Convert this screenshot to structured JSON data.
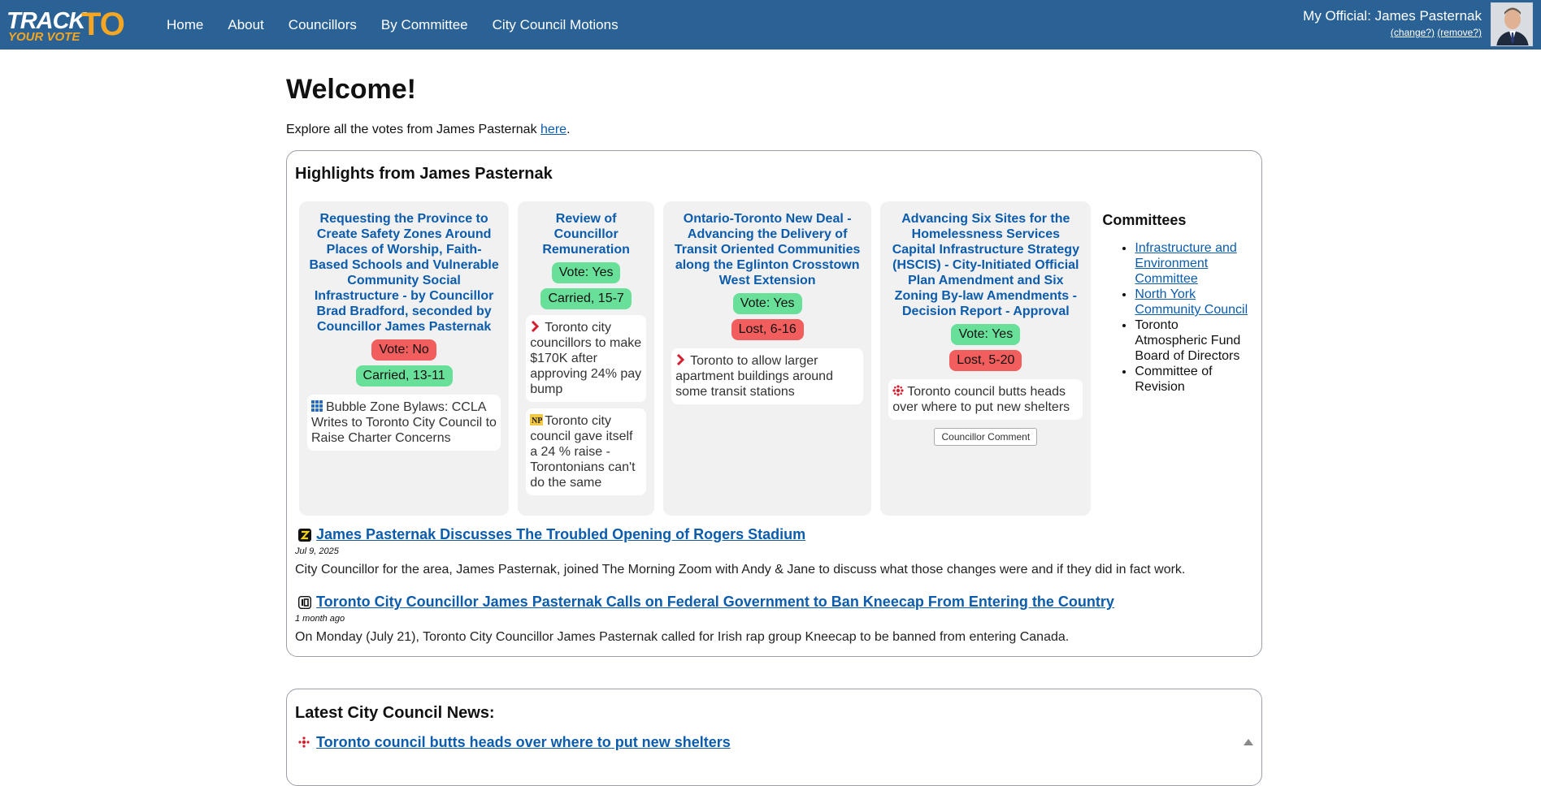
{
  "logo": {
    "line1": "TRACK",
    "line2": "YOUR VOTE",
    "line3": "TO"
  },
  "nav": {
    "items": [
      {
        "label": "Home"
      },
      {
        "label": "About"
      },
      {
        "label": "Councillors"
      },
      {
        "label": "By Committee"
      },
      {
        "label": "City Council Motions"
      }
    ]
  },
  "official": {
    "label": "My Official: James Pasternak",
    "change_link": "(change?)",
    "remove_link": "(remove?)"
  },
  "welcome": {
    "title": "Welcome!",
    "explore_prefix": "Explore all the votes from James Pasternak ",
    "explore_link": "here",
    "explore_suffix": "."
  },
  "highlights": {
    "title": "Highlights from James Pasternak",
    "cards": [
      {
        "title": "Requesting the Province to Create Safety Zones Around Places of Worship, Faith-Based Schools and Vulnerable Community Social Infrastructure - by Councillor Brad Bradford, seconded by Councillor James Pasternak",
        "vote": "Vote: No",
        "result": "Carried, 13-11",
        "news": [
          {
            "icon": "grid-icon",
            "text": "Bubble Zone Bylaws: CCLA Writes to Toronto City Council to Raise Charter Concerns"
          }
        ]
      },
      {
        "title": "Review of Councillor Remuneration",
        "vote": "Vote: Yes",
        "result": "Carried, 15-7",
        "news": [
          {
            "icon": "chevron-icon",
            "text": "Toronto city councillors to make $170K after approving 24% pay bump"
          },
          {
            "icon": "np-icon",
            "text": "Toronto city council gave itself a 24 % raise - Torontonians can't do the same"
          }
        ]
      },
      {
        "title": "Ontario-Toronto New Deal - Advancing the Delivery of Transit Oriented Communities along the Eglinton Crosstown West Extension",
        "vote": "Vote: Yes",
        "result": "Lost, 6-16",
        "news": [
          {
            "icon": "chevron-icon",
            "text": "Toronto to allow larger apartment buildings around some transit stations"
          }
        ]
      },
      {
        "title": "Advancing Six Sites for the Homelessness Services Capital Infrastructure Strategy (HSCIS) - City-Initiated Official Plan Amendment and Six Zoning By-law Amendments - Decision Report - Approval",
        "vote": "Vote: Yes",
        "result": "Lost, 5-20",
        "news": [
          {
            "icon": "cbc-icon",
            "text": "Toronto council butts heads over where to put new shelters"
          }
        ],
        "button": "Councillor Comment"
      }
    ],
    "committees": {
      "title": "Committees",
      "items": [
        {
          "label": "Infrastructure and Environment Committee",
          "link": true
        },
        {
          "label": "North York Community Council",
          "link": true
        },
        {
          "label": "Toronto Atmospheric Fund Board of Directors",
          "link": false
        },
        {
          "label": "Committee of Revision",
          "link": false
        }
      ]
    },
    "articles": [
      {
        "icon": "zoomer-icon",
        "title": "James Pasternak Discusses The Troubled Opening of Rogers Stadium",
        "date": "Jul 9, 2025",
        "desc": "City Councillor for the area, James Pasternak, joined The Morning Zoom with Andy & Jane to discuss what those changes were and if they did in fact work."
      },
      {
        "icon": "news-outlet-icon",
        "title": "Toronto City Councillor James Pasternak Calls on Federal Government to Ban Kneecap From Entering the Country",
        "date": "1 month ago",
        "desc": "On Monday (July 21), Toronto City Councillor James Pasternak called for Irish rap group Kneecap to be banned from entering Canada."
      }
    ]
  },
  "latest": {
    "title": "Latest City Council News:",
    "first_item": "Toronto council butts heads over where to put new shelters"
  },
  "colors": {
    "nav_bg": "#2a6296",
    "accent": "#f5a623",
    "link": "#0b5cad",
    "vote_yes": "#69e09a",
    "vote_no": "#f25d5d"
  }
}
